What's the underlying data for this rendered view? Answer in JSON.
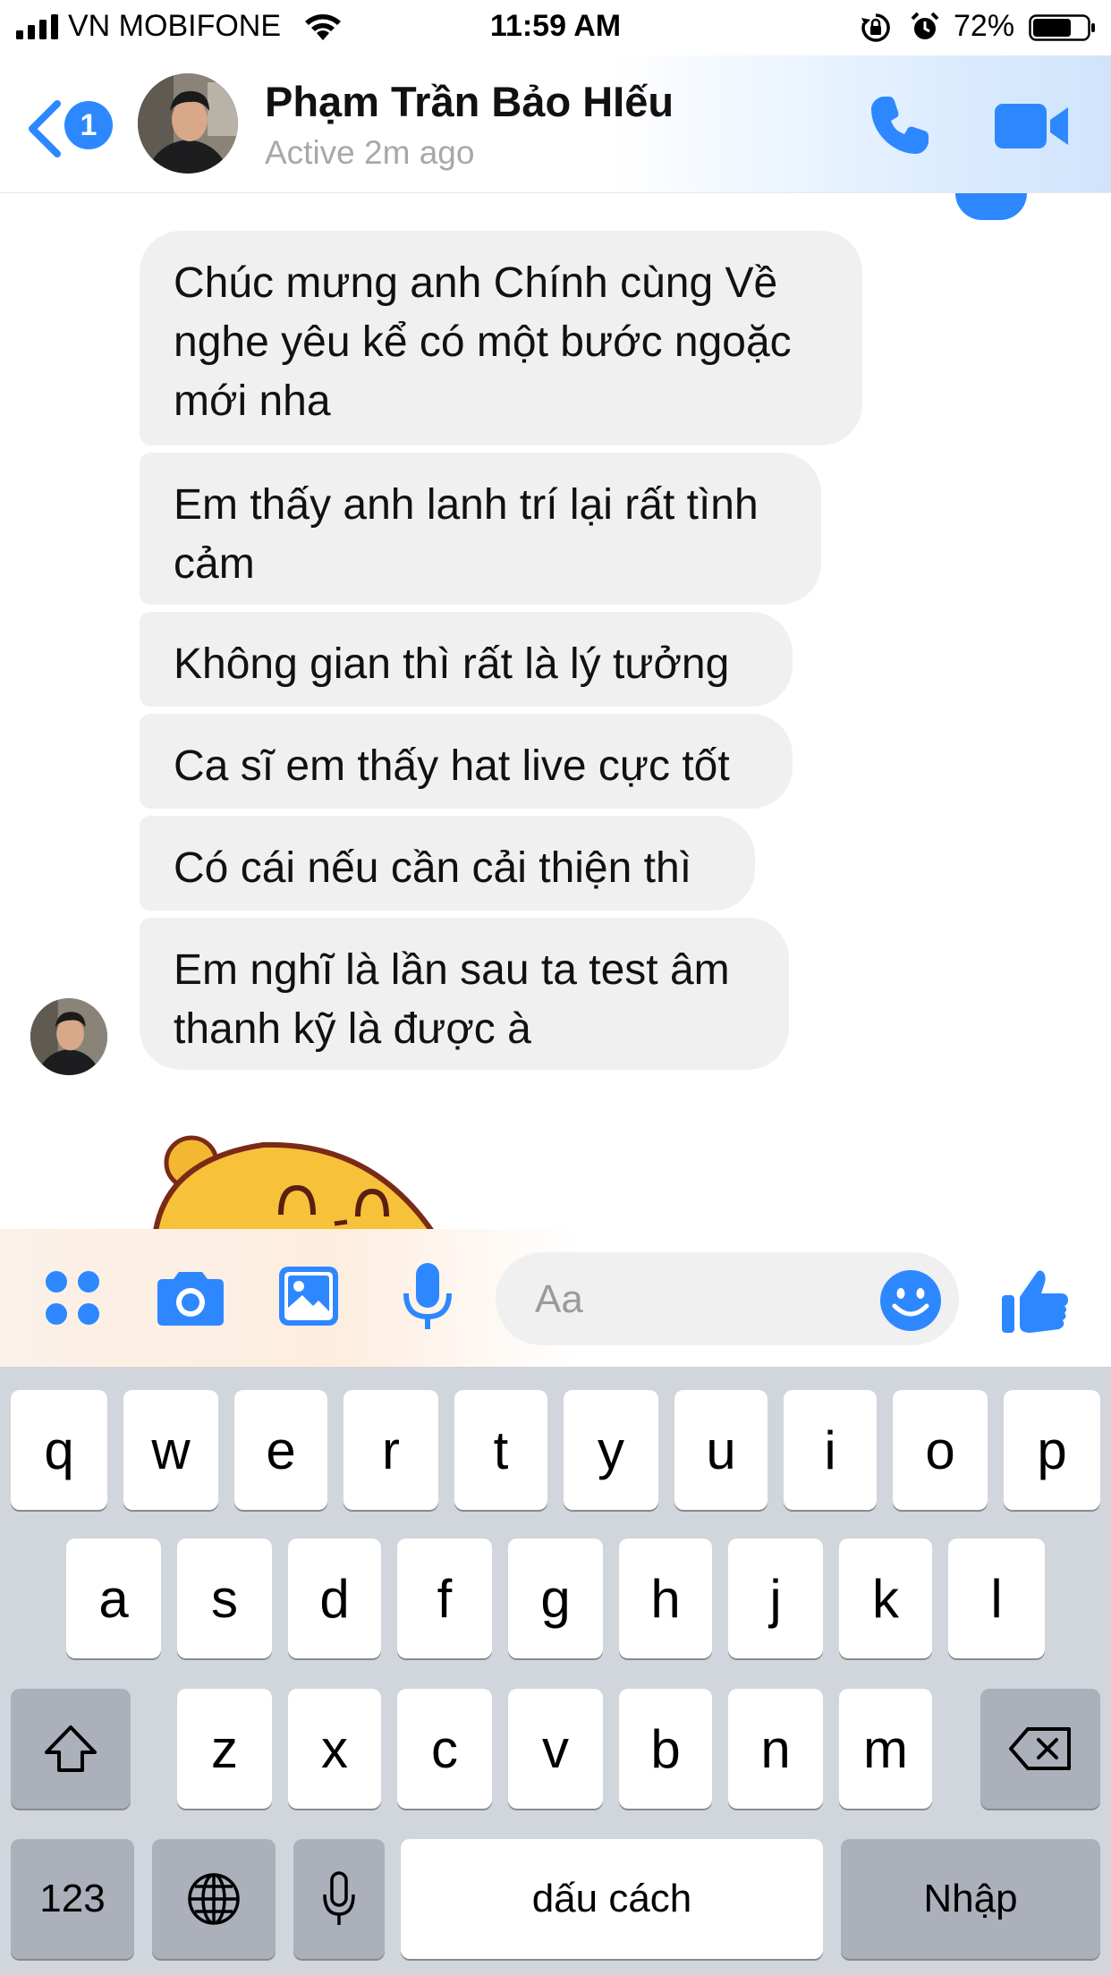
{
  "status_bar": {
    "carrier": "VN MOBIFONE",
    "time": "11:59 AM",
    "battery_percent": "72%",
    "battery_level": 0.72,
    "icons": [
      "signal-icon",
      "wifi-icon",
      "orientation-lock-icon",
      "alarm-icon",
      "battery-icon"
    ]
  },
  "header": {
    "back_badge": "1",
    "contact_name": "Phạm Trần Bảo HIếu",
    "contact_status": "Active 2m ago",
    "icons": [
      "back-chevron-icon",
      "phone-icon",
      "video-camera-icon"
    ],
    "accent_color": "#2d88ff"
  },
  "messages": [
    {
      "text": "Chúc mưng anh Chính cùng Về nghe yêu kể có một bước ngoặc mới nha"
    },
    {
      "text": "Em thấy anh lanh trí lại rất tình cảm"
    },
    {
      "text": "Không gian thì rất là lý tưởng"
    },
    {
      "text": "Ca sĩ em thấy hat live cực tốt"
    },
    {
      "text": "Có cái nếu cần cải thiện thì"
    },
    {
      "text": "Em nghĩ là lần sau ta test âm thanh kỹ là được à"
    }
  ],
  "composer": {
    "placeholder": "Aa",
    "icons": [
      "apps-grid-icon",
      "camera-icon",
      "gallery-icon",
      "microphone-icon",
      "emoji-icon",
      "thumbs-up-icon"
    ]
  },
  "keyboard": {
    "row1": [
      "q",
      "w",
      "e",
      "r",
      "t",
      "y",
      "u",
      "i",
      "o",
      "p"
    ],
    "row2": [
      "a",
      "s",
      "d",
      "f",
      "g",
      "h",
      "j",
      "k",
      "l"
    ],
    "row3": [
      "z",
      "x",
      "c",
      "v",
      "b",
      "n",
      "m"
    ],
    "numbers_key": "123",
    "space_key": "dấu cách",
    "return_key": "Nhập",
    "icons": [
      "shift-icon",
      "backspace-icon",
      "globe-icon",
      "dictation-icon"
    ]
  }
}
